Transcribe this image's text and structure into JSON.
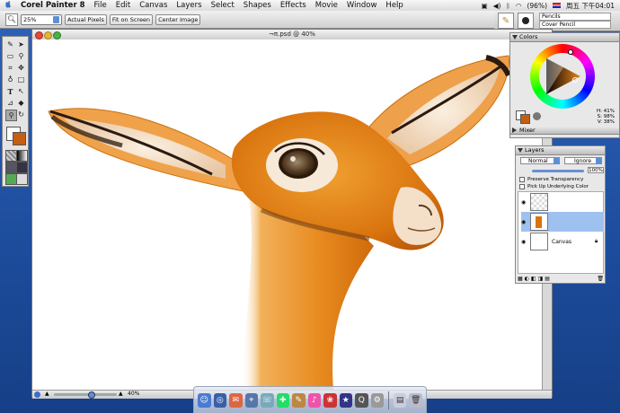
{
  "menubar": {
    "apple": "",
    "app_name": "Corel Painter 8",
    "items": [
      "File",
      "Edit",
      "Canvas",
      "Layers",
      "Select",
      "Shapes",
      "Effects",
      "Movie",
      "Window",
      "Help"
    ],
    "battery": "(96%)",
    "clock": "周五 下午04:01"
  },
  "propbar": {
    "zoom_value": "25%",
    "actual_pixels": "Actual Pixels",
    "fit_on_screen": "Fit on Screen",
    "center_image": "Center Image"
  },
  "brush": {
    "category": "Pencils",
    "variant": "Cover Pencil"
  },
  "document": {
    "title": "¬π.psd @ 40%",
    "status_zoom": "40%"
  },
  "colors_palette": {
    "title": "Colors",
    "h": "H: 41%",
    "s": "S: 98%",
    "v": "V: 38%",
    "main_color": "#c45f12",
    "mixer_title": "Mixer"
  },
  "layers_palette": {
    "title": "Layers",
    "blend_mode": "Normal",
    "composite": "Ignore",
    "opacity": "100%",
    "preserve_transparency": "Preserve Transparency",
    "pick_up_underlying": "Pick Up Underlying Color",
    "layers": [
      {
        "name": ""
      },
      {
        "name": ""
      },
      {
        "name": "Canvas"
      }
    ]
  },
  "icons": {
    "apple": "apple-icon",
    "zoom": "magnifier-icon"
  }
}
